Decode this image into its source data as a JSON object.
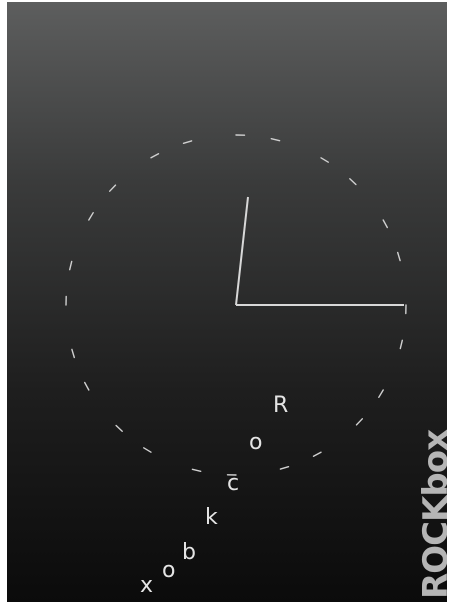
{
  "clock": {
    "title": "",
    "hour_hand_time": "12:00",
    "minute_hand_time": "00:15",
    "tick_count": 60
  },
  "scroller": {
    "text": "Rockbox",
    "letters": [
      "R",
      "o",
      "c",
      "k",
      "b",
      "o",
      "x"
    ]
  },
  "logo": {
    "text": "ROCKbox",
    "rock": "ROCK",
    "box": "box"
  },
  "colors": {
    "background_top": "#5d5e5e",
    "background_bottom": "#0b0b0b",
    "foreground": "#d8d8d8",
    "logo": "#b5b5b5"
  }
}
